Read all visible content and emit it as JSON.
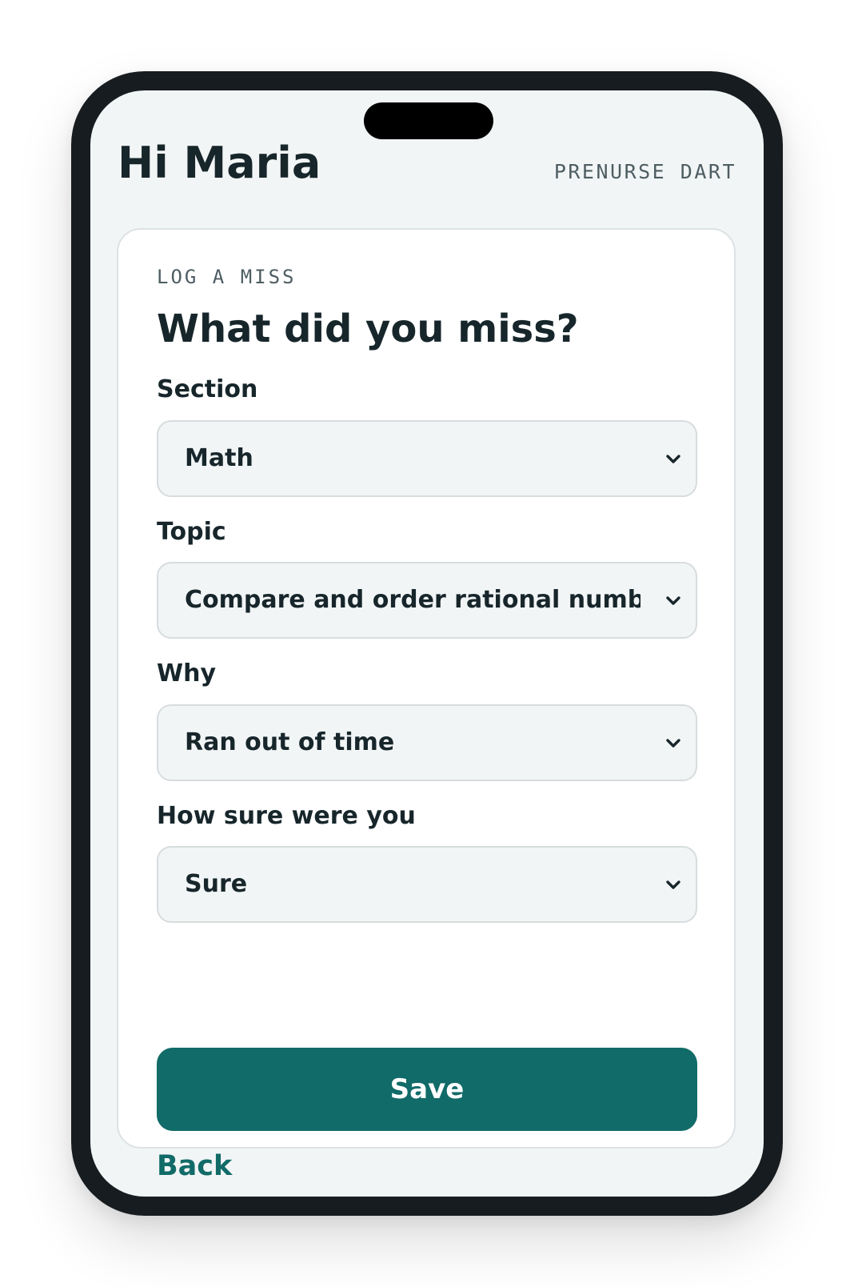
{
  "header": {
    "greeting": "Hi Maria",
    "brand": "PRENURSE DART"
  },
  "form": {
    "eyebrow": "LOG A MISS",
    "title": "What did you miss?",
    "fields": [
      {
        "label": "Section",
        "value": "Math"
      },
      {
        "label": "Topic",
        "value": "Compare and order rational numbers"
      },
      {
        "label": "Why",
        "value": "Ran out of time"
      },
      {
        "label": "How sure were you",
        "value": "Sure"
      }
    ],
    "save_label": "Save",
    "back_label": "Back"
  },
  "icons": {
    "dropdown": "chevron-down-icon"
  },
  "colors": {
    "accent": "#116b68",
    "text": "#17262b",
    "muted": "#4e5d62",
    "screen_background": "#f2f5f6",
    "device_frame": "#171c20"
  }
}
